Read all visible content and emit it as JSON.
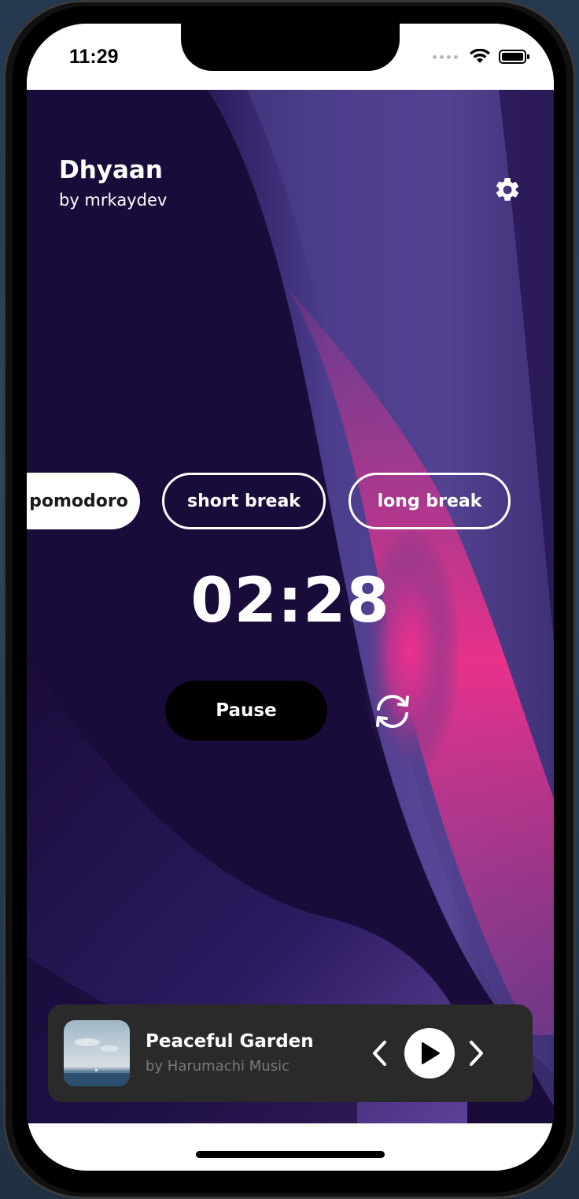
{
  "status_bar": {
    "time": "11:29"
  },
  "app": {
    "title": "Dhyaan",
    "subtitle": "by mrkaydev",
    "settings_icon": "gear-icon"
  },
  "modes": {
    "active": "pomodoro",
    "pomodoro": "pomodoro",
    "short_break": "short break",
    "long_break": "long break"
  },
  "timer": {
    "display": "02:28"
  },
  "controls": {
    "pause_label": "Pause",
    "reset_icon": "reset-icon"
  },
  "player": {
    "title": "Peaceful Garden",
    "artist": "by Harumachi Music",
    "prev_icon": "chevron-left-icon",
    "play_icon": "play-icon",
    "next_icon": "chevron-right-icon"
  },
  "colors": {
    "background_dark": "#1c0d3d",
    "gradient_purple": "#4f3f8c",
    "gradient_pink": "#e8318b",
    "player_bg": "#2a2a2a",
    "button_black": "#000000",
    "text_white": "#ffffff"
  }
}
